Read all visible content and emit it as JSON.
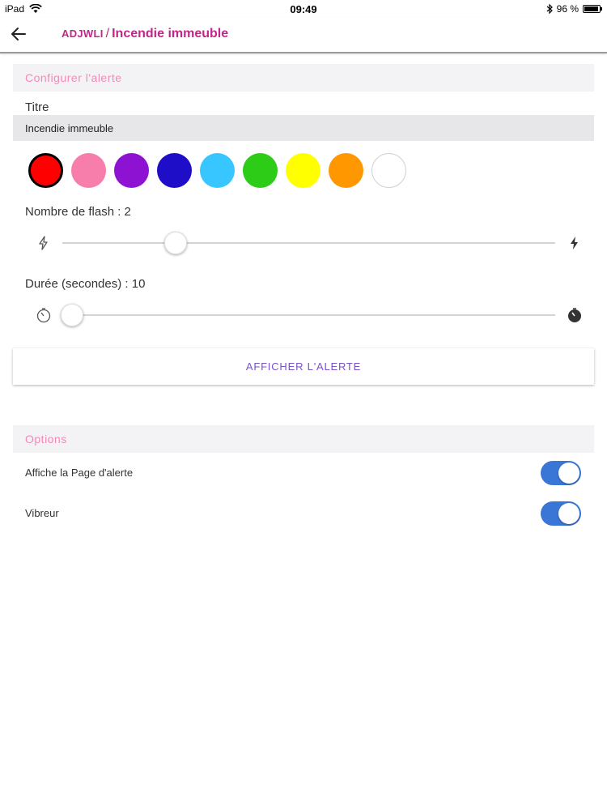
{
  "status_bar": {
    "device": "iPad",
    "time": "09:49",
    "battery": "96 %"
  },
  "header": {
    "prefix": "ADJWLI",
    "separator": "/",
    "title": "Incendie immeuble"
  },
  "configure": {
    "section_title": "Configurer l'alerte",
    "title_label": "Titre",
    "title_value": "Incendie immeuble",
    "colors": [
      "#ff0000",
      "#f77eaa",
      "#8e12d2",
      "#1e0ec8",
      "#37c6ff",
      "#2ccc17",
      "#ffff00",
      "#ff9800",
      "#ffffff"
    ],
    "selected_color_index": 0,
    "flash_label": "Nombre de flash : 2",
    "flash_level": 0.23,
    "duration_label": "Durée (secondes) : 10",
    "duration_level": 0.02,
    "show_alert_button": "AFFICHER L'ALERTE"
  },
  "options": {
    "section_title": "Options",
    "items": [
      {
        "label": "Affiche la Page d'alerte",
        "enabled": true
      },
      {
        "label": "Vibreur",
        "enabled": true
      }
    ]
  }
}
